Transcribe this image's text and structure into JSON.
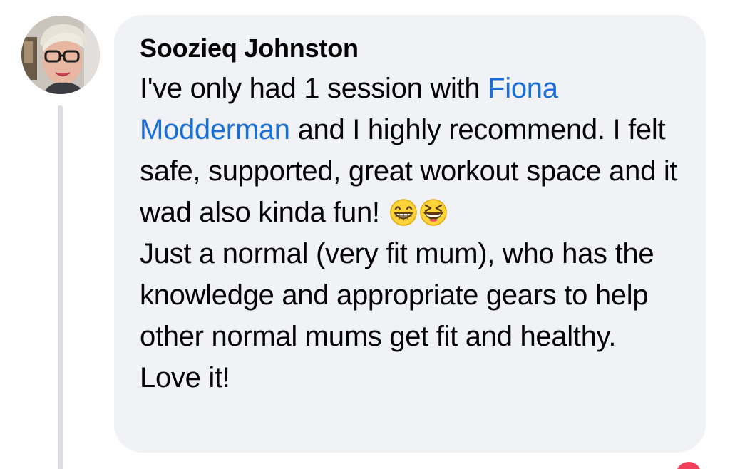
{
  "comment": {
    "author": "Soozieq Johnston",
    "text_part1": "I've only had 1 session with ",
    "mention": "Fiona Modderman",
    "text_part2": "  and I highly recommend. I felt safe, supported, great workout space and it wad also kinda fun! ",
    "emoji_1": "grinning-face-with-smiling-eyes",
    "emoji_2": "grinning-squinting-face",
    "text_part3": "Just a normal (very fit mum), who has the knowledge and appropriate gears to help other normal mums get fit and healthy. Love it!"
  },
  "colors": {
    "bubble": "#f0f2f5",
    "mention": "#1a6ed8",
    "text": "#050505",
    "reaction": "#f0405a"
  }
}
